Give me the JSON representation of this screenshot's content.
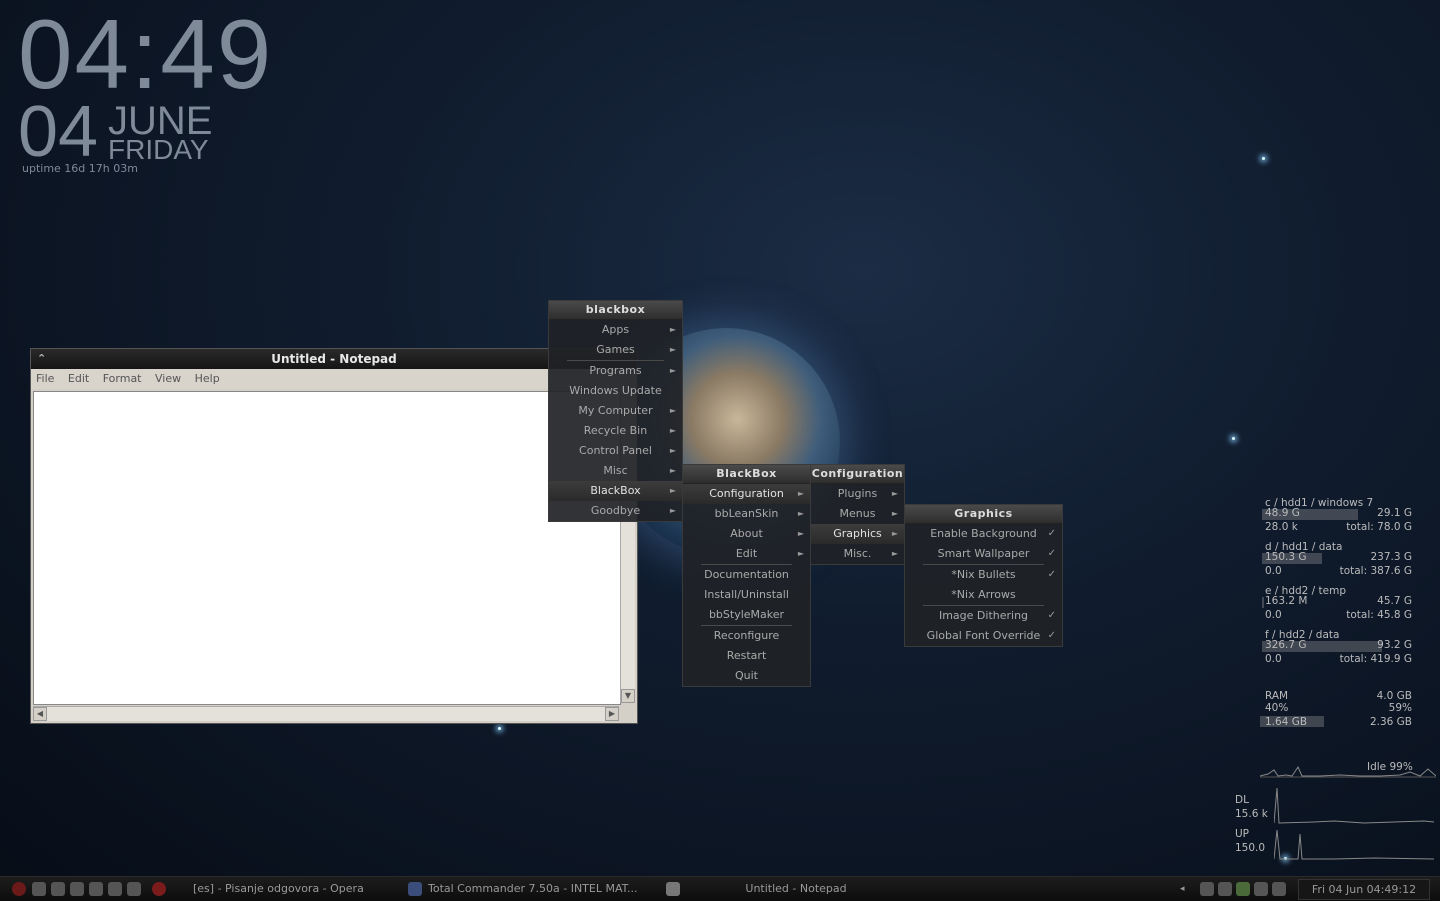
{
  "clock": {
    "time": "04:49",
    "day": "04",
    "month": "JUNE",
    "weekday": "FRIDAY",
    "uptime": "uptime 16d 17h 03m"
  },
  "notepad": {
    "title": "Untitled - Notepad",
    "menu": [
      "File",
      "Edit",
      "Format",
      "View",
      "Help"
    ]
  },
  "menus": {
    "root": {
      "title": "blackbox",
      "items": [
        "Apps",
        "Games",
        "Programs",
        "Windows Update",
        "My Computer",
        "Recycle Bin",
        "Control Panel",
        "Misc",
        "BlackBox",
        "Goodbye"
      ]
    },
    "blackbox": {
      "title": "BlackBox",
      "items": [
        "Configuration",
        "bbLeanSkin",
        "About",
        "Edit",
        "Documentation",
        "Install/Uninstall",
        "bbStyleMaker",
        "Reconfigure",
        "Restart",
        "Quit"
      ]
    },
    "configuration": {
      "title": "Configuration",
      "items": [
        "Plugins",
        "Menus",
        "Graphics",
        "Misc."
      ]
    },
    "graphics": {
      "title": "Graphics",
      "items": [
        "Enable Background",
        "Smart Wallpaper",
        "*Nix Bullets",
        "*Nix Arrows",
        "Image Dithering",
        "Global Font Override"
      ]
    }
  },
  "drives": [
    {
      "label": "c / hdd1 / windows 7",
      "used": "48.9 G",
      "free": "29.1 G",
      "rate": "28.0 k",
      "total": "total: 78.0 G",
      "fill": 0.63
    },
    {
      "label": "d / hdd1 / data",
      "used": "150.3 G",
      "free": "237.3 G",
      "rate": "0.0",
      "total": "total: 387.6 G",
      "fill": 0.39
    },
    {
      "label": "e / hdd2 / temp",
      "used": "163.2 M",
      "free": "45.7 G",
      "rate": "0.0",
      "total": "total: 45.8 G",
      "fill": 0.01
    },
    {
      "label": "f / hdd2 / data",
      "used": "326.7 G",
      "free": "93.2 G",
      "rate": "0.0",
      "total": "total: 419.9 G",
      "fill": 0.78
    }
  ],
  "ram": {
    "label": "RAM",
    "total": "4.0 GB",
    "used_pct": "40%",
    "free_pct": "59%",
    "used": "1.64 GB",
    "free": "2.36 GB",
    "fill": 0.41
  },
  "cpu": {
    "idle": "Idle 99%"
  },
  "net": {
    "dl_label": "DL",
    "dl": "15.6 k",
    "up_label": "UP",
    "up": "150.0"
  },
  "taskbar": {
    "tasks": [
      "[es] - Pisanje odgovora - Opera",
      "Total Commander 7.50a - INTEL MAT...",
      "Untitled - Notepad"
    ],
    "clock": "Fri 04 Jun 04:49:12"
  }
}
